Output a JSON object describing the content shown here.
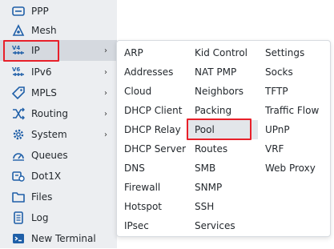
{
  "sidebar": {
    "items": [
      {
        "label": "PPP",
        "icon": "ppp-icon",
        "has_submenu": false
      },
      {
        "label": "Mesh",
        "icon": "mesh-icon",
        "has_submenu": false
      },
      {
        "label": "IP",
        "icon": "ip-icon",
        "has_submenu": true,
        "active": true
      },
      {
        "label": "IPv6",
        "icon": "ipv6-icon",
        "has_submenu": true
      },
      {
        "label": "MPLS",
        "icon": "mpls-icon",
        "has_submenu": true
      },
      {
        "label": "Routing",
        "icon": "routing-icon",
        "has_submenu": true
      },
      {
        "label": "System",
        "icon": "gear-icon",
        "has_submenu": true
      },
      {
        "label": "Queues",
        "icon": "queues-icon",
        "has_submenu": false
      },
      {
        "label": "Dot1X",
        "icon": "dot1x-icon",
        "has_submenu": false
      },
      {
        "label": "Files",
        "icon": "folder-icon",
        "has_submenu": false
      },
      {
        "label": "Log",
        "icon": "log-icon",
        "has_submenu": false
      },
      {
        "label": "New Terminal",
        "icon": "terminal-icon",
        "has_submenu": false
      }
    ],
    "chevron": "›"
  },
  "ip_menu": {
    "columns": [
      [
        "ARP",
        "Addresses",
        "Cloud",
        "DHCP Client",
        "DHCP Relay",
        "DHCP Server",
        "DNS",
        "Firewall",
        "Hotspot",
        "IPsec"
      ],
      [
        "Kid Control",
        "NAT PMP",
        "Neighbors",
        "Packing",
        "Pool",
        "Routes",
        "SMB",
        "SNMP",
        "SSH",
        "Services"
      ],
      [
        "Settings",
        "Socks",
        "TFTP",
        "Traffic Flow",
        "UPnP",
        "VRF",
        "Web Proxy"
      ]
    ],
    "hovered": "Pool"
  },
  "colors": {
    "sidebar_bg": "#eceef1",
    "active_bg": "#d5d9df",
    "highlight": "#e8202a",
    "icon_blue": "#1f5fa8"
  }
}
